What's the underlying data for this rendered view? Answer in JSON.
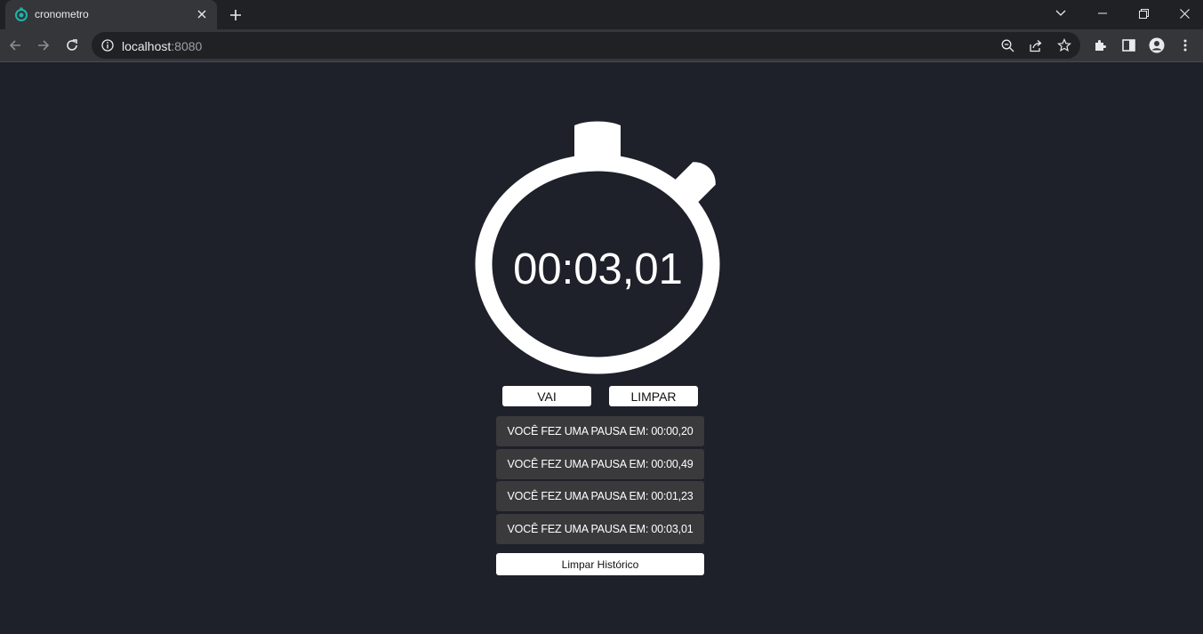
{
  "browser": {
    "tab_title": "cronometro",
    "url_host": "localhost",
    "url_port": ":8080"
  },
  "stopwatch": {
    "time": "00:03,01"
  },
  "controls": {
    "start_label": "VAI",
    "reset_label": "LIMPAR"
  },
  "history": {
    "items": [
      "VOCÊ FEZ UMA PAUSA EM: 00:00,20",
      "VOCÊ FEZ UMA PAUSA EM: 00:00,49",
      "VOCÊ FEZ UMA PAUSA EM: 00:01,23",
      "VOCÊ FEZ UMA PAUSA EM: 00:03,01"
    ],
    "clear_label": "Limpar Histórico"
  },
  "colors": {
    "background": "#1e202a",
    "history_item": "#3a3a3c",
    "favicon_accent": "#1fb5a8"
  }
}
